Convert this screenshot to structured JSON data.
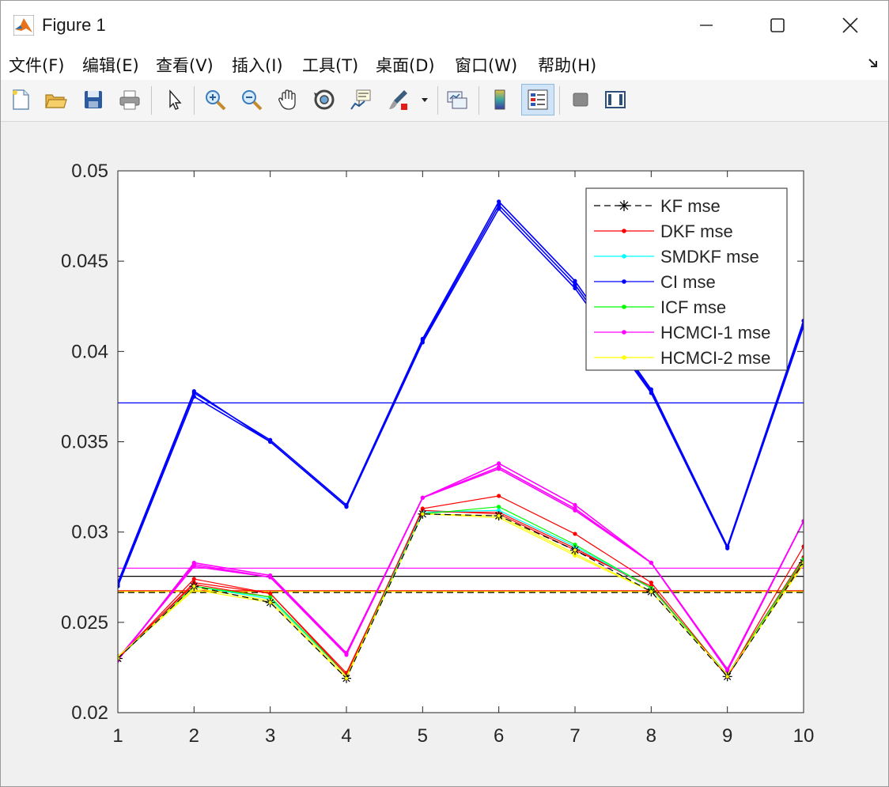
{
  "window": {
    "title": "Figure 1"
  },
  "menu": [
    "文件(F)",
    "编辑(E)",
    "查看(V)",
    "插入(I)",
    "工具(T)",
    "桌面(D)",
    "窗口(W)",
    "帮助(H)"
  ],
  "toolbar": {
    "icons": [
      "new-file-icon",
      "open-folder-icon",
      "save-icon",
      "print-icon",
      "pointer-icon",
      "zoom-in-icon",
      "zoom-out-icon",
      "pan-hand-icon",
      "rotate-3d-icon",
      "data-tips-icon",
      "brush-icon",
      "brush-dropdown-icon",
      "link-plot-icon",
      "colorbar-icon",
      "legend-icon",
      "hide-plot-tools-icon",
      "show-plot-tools-icon"
    ]
  },
  "colors": {
    "KF": "#000000",
    "DKF": "#ff0000",
    "SMDKF": "#00ffff",
    "CI": "#0000ff",
    "ICF": "#00ff00",
    "HCMCI1": "#ff00ff",
    "HCMCI2": "#ffff00"
  },
  "chart_data": {
    "type": "line",
    "x": [
      1,
      2,
      3,
      4,
      5,
      6,
      7,
      8,
      9,
      10
    ],
    "xlim": [
      1,
      10
    ],
    "ylim": [
      0.02,
      0.05
    ],
    "xticks": [
      "1",
      "2",
      "3",
      "4",
      "5",
      "6",
      "7",
      "8",
      "9",
      "10"
    ],
    "yticks": [
      "0.02",
      "0.025",
      "0.03",
      "0.035",
      "0.04",
      "0.045",
      "0.05"
    ],
    "legend_position": "top-right",
    "legend": [
      "KF mse",
      "DKF mse",
      "SMDKF mse",
      "CI mse",
      "ICF mse",
      "HCMCI-1 mse",
      "HCMCI-2 mse"
    ],
    "series": [
      {
        "name": "KF mse",
        "color": "#000000",
        "style": "dashed",
        "marker": "star",
        "values": [
          0.023,
          0.027,
          0.0261,
          0.0219,
          0.031,
          0.0309,
          0.029,
          0.0267,
          0.022,
          0.0283
        ]
      },
      {
        "name": "DKF mse",
        "color": "#ff0000",
        "marker": "dot",
        "values": [
          0.023,
          0.0272,
          0.0266,
          0.0221,
          0.0313,
          0.032,
          0.0299,
          0.0272,
          0.022,
          0.0292
        ]
      },
      {
        "name": "SMDKF mse",
        "color": "#00ffff",
        "marker": "dot",
        "values": [
          0.023,
          0.027,
          0.0263,
          0.0221,
          0.0311,
          0.0312,
          0.0292,
          0.0269,
          0.0221,
          0.0285
        ]
      },
      {
        "name": "CI mse",
        "color": "#0000ff",
        "marker": "dot",
        "values": [
          0.0271,
          0.0377,
          0.0351,
          0.0315,
          0.0407,
          0.0483,
          0.0439,
          0.0379,
          0.0292,
          0.0417
        ]
      },
      {
        "name": "ICF mse",
        "color": "#00ff00",
        "marker": "dot",
        "values": [
          0.023,
          0.027,
          0.0264,
          0.0221,
          0.031,
          0.0314,
          0.0293,
          0.0269,
          0.0221,
          0.0285
        ]
      },
      {
        "name": "HCMCI-1 mse",
        "color": "#ff00ff",
        "marker": "dot",
        "values": [
          0.0229,
          0.0283,
          0.0276,
          0.0233,
          0.0319,
          0.0338,
          0.0315,
          0.0283,
          0.0224,
          0.0306
        ]
      },
      {
        "name": "HCMCI-2 mse",
        "color": "#ffff00",
        "marker": "dot",
        "values": [
          0.0231,
          0.0269,
          0.0262,
          0.022,
          0.031,
          0.0308,
          0.0287,
          0.0267,
          0.0221,
          0.0283
        ]
      }
    ],
    "extra_series": [
      {
        "color": "#ff0000",
        "values": [
          0.023,
          0.0274,
          0.0266,
          0.0222,
          0.0311,
          0.0311,
          0.0291,
          0.0269,
          0.0221,
          0.0286
        ]
      },
      {
        "color": "#ff0000",
        "values": [
          0.0231,
          0.0271,
          0.0264,
          0.0221,
          0.0312,
          0.031,
          0.029,
          0.027,
          0.022,
          0.0284
        ]
      },
      {
        "color": "#0000ff",
        "values": [
          0.027,
          0.0375,
          0.035,
          0.0314,
          0.0405,
          0.0479,
          0.0435,
          0.0377,
          0.0291,
          0.0414
        ]
      },
      {
        "color": "#0000ff",
        "values": [
          0.0272,
          0.0378,
          0.035,
          0.0314,
          0.0406,
          0.0481,
          0.0437,
          0.0378,
          0.0292,
          0.0415
        ]
      },
      {
        "color": "#ff00ff",
        "values": [
          0.023,
          0.0281,
          0.0275,
          0.0232,
          0.0319,
          0.0336,
          0.0313,
          0.0283,
          0.0224,
          0.0306
        ]
      },
      {
        "color": "#ff00ff",
        "values": [
          0.0229,
          0.0282,
          0.0275,
          0.0233,
          0.0319,
          0.0335,
          0.0312,
          0.0283,
          0.0223,
          0.0306
        ]
      },
      {
        "color": "#ffff00",
        "values": [
          0.0231,
          0.0268,
          0.0261,
          0.0219,
          0.031,
          0.0309,
          0.0288,
          0.0267,
          0.0221,
          0.0282
        ]
      }
    ],
    "mean_lines": [
      {
        "color": "#0000ff",
        "value": 0.03715
      },
      {
        "color": "#ff00ff",
        "value": 0.028
      },
      {
        "color": "#000000",
        "value": 0.02755
      },
      {
        "color": "#ff0000",
        "value": 0.02675
      },
      {
        "color": "#ffff00",
        "value": 0.0267
      },
      {
        "color": "#000000",
        "value": 0.02665,
        "style": "dashed"
      }
    ]
  }
}
